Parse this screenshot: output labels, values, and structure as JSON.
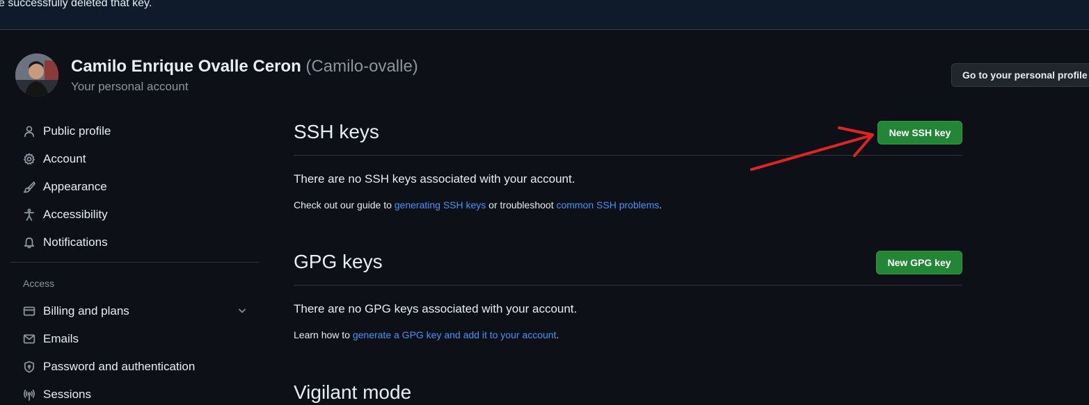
{
  "banner": {
    "message": "e successfully deleted that key."
  },
  "user": {
    "name": "Camilo Enrique Ovalle Ceron",
    "handle": "(Camilo-ovalle)",
    "subtitle": "Your personal account",
    "profile_button": "Go to your personal profile"
  },
  "sidebar": {
    "items": [
      {
        "label": "Public profile",
        "icon": "person-icon"
      },
      {
        "label": "Account",
        "icon": "gear-icon"
      },
      {
        "label": "Appearance",
        "icon": "paintbrush-icon"
      },
      {
        "label": "Accessibility",
        "icon": "accessibility-icon"
      },
      {
        "label": "Notifications",
        "icon": "bell-icon"
      }
    ],
    "access_heading": "Access",
    "access_items": [
      {
        "label": "Billing and plans",
        "icon": "credit-card-icon",
        "expandable": true
      },
      {
        "label": "Emails",
        "icon": "mail-icon"
      },
      {
        "label": "Password and authentication",
        "icon": "shield-lock-icon"
      },
      {
        "label": "Sessions",
        "icon": "broadcast-icon"
      }
    ]
  },
  "ssh": {
    "title": "SSH keys",
    "button": "New SSH key",
    "empty_text": "There are no SSH keys associated with your account.",
    "help_prefix": "Check out our guide to ",
    "help_link1": "generating SSH keys",
    "help_middle": " or troubleshoot ",
    "help_link2": "common SSH problems",
    "help_suffix": "."
  },
  "gpg": {
    "title": "GPG keys",
    "button": "New GPG key",
    "empty_text": "There are no GPG keys associated with your account.",
    "help_prefix": "Learn how to ",
    "help_link": "generate a GPG key and add it to your account",
    "help_suffix": "."
  },
  "vigilant": {
    "title": "Vigilant mode"
  },
  "colors": {
    "background": "#0d1117",
    "banner": "#0f1a2b",
    "button_green": "#238636",
    "link": "#4493f8",
    "annotation_arrow": "#e02424"
  }
}
